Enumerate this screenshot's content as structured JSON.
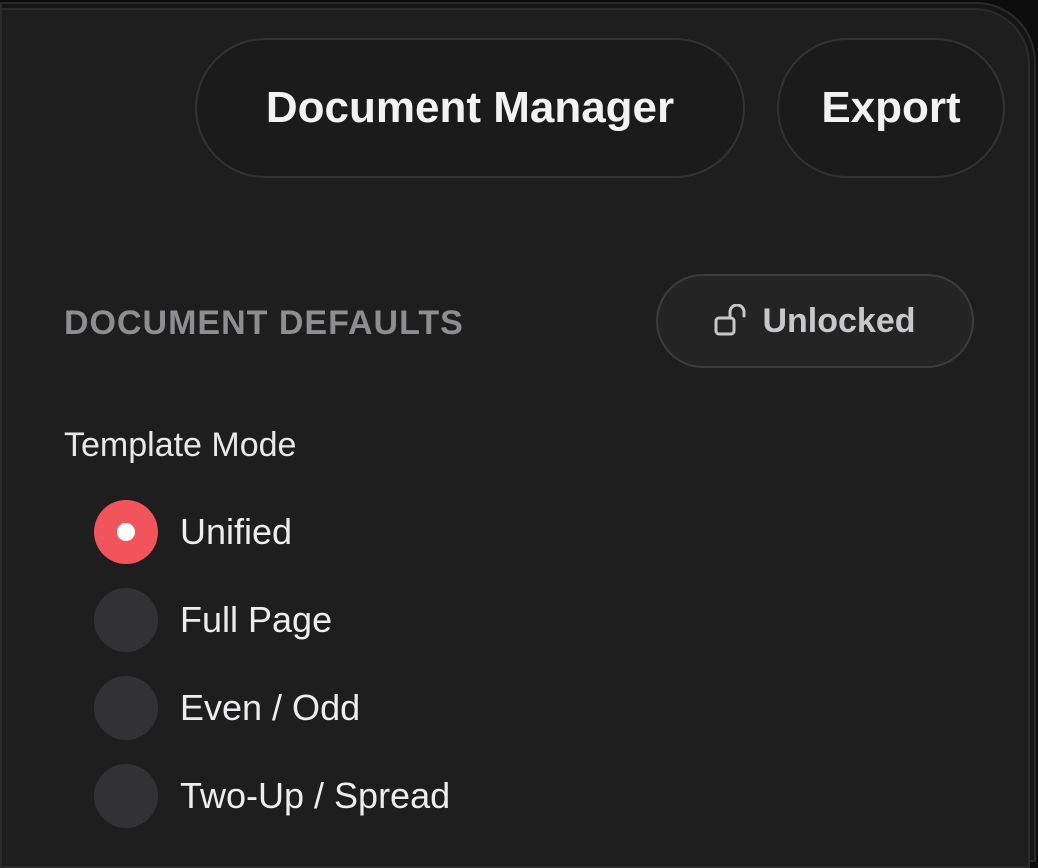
{
  "toolbar": {
    "document_manager_label": "Document Manager",
    "export_label": "Export"
  },
  "defaults_section": {
    "title": "DOCUMENT DEFAULTS",
    "lock_button": {
      "label": "Unlocked",
      "icon": "unlock-icon"
    }
  },
  "template_mode": {
    "label": "Template Mode",
    "selected": "Unified",
    "options": [
      {
        "label": "Unified",
        "selected": true
      },
      {
        "label": "Full Page",
        "selected": false
      },
      {
        "label": "Even / Odd",
        "selected": false
      },
      {
        "label": "Two-Up / Spread",
        "selected": false
      }
    ]
  },
  "colors": {
    "accent": "#f2545b",
    "background": "#1e1e1f",
    "radio_unselected": "#323234"
  }
}
